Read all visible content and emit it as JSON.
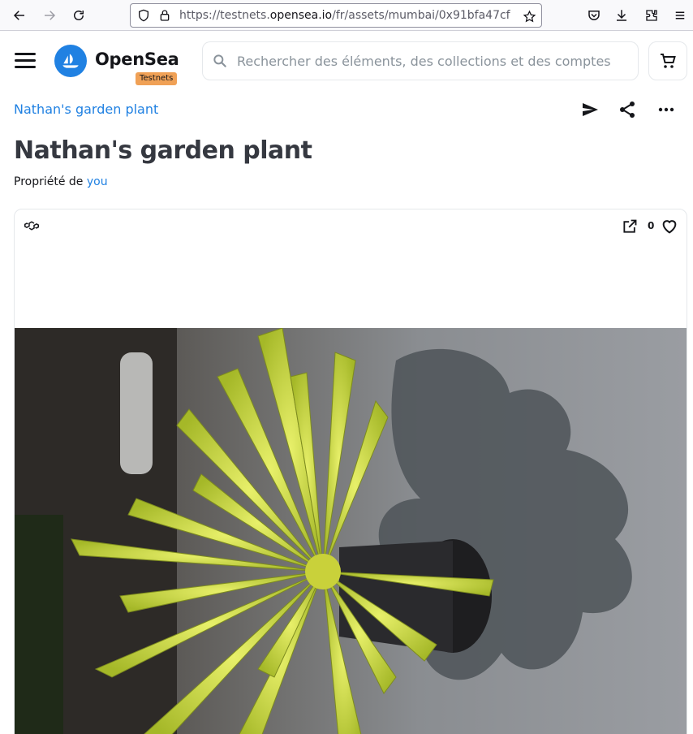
{
  "browser": {
    "url_prefix": "https://testnets.",
    "url_domain": "opensea.io",
    "url_suffix": "/fr/assets/mumbai/0x91bfa47cf"
  },
  "header": {
    "brand": "OpenSea",
    "badge": "Testnets",
    "search_placeholder": "Rechercher des éléments, des collections et des comptes"
  },
  "asset": {
    "collection": "Nathan's garden plant",
    "title": "Nathan's garden plant",
    "owner_label": "Propriété de",
    "owner_name": "you",
    "favorites": "0"
  },
  "icons": {
    "nav": [
      "back-icon",
      "forward-icon",
      "reload-icon"
    ],
    "url": [
      "shield-icon",
      "lock-icon",
      "star-icon"
    ],
    "toolbar": [
      "pocket-icon",
      "download-icon",
      "extensions-icon",
      "menu-icon"
    ],
    "actions": [
      "send-icon",
      "share-icon",
      "more-icon"
    ],
    "card": [
      "polygon-chain-icon",
      "external-link-icon",
      "heart-icon"
    ]
  },
  "colors": {
    "accent": "#2081e2",
    "badge": "#f0a156",
    "title": "#353840"
  }
}
